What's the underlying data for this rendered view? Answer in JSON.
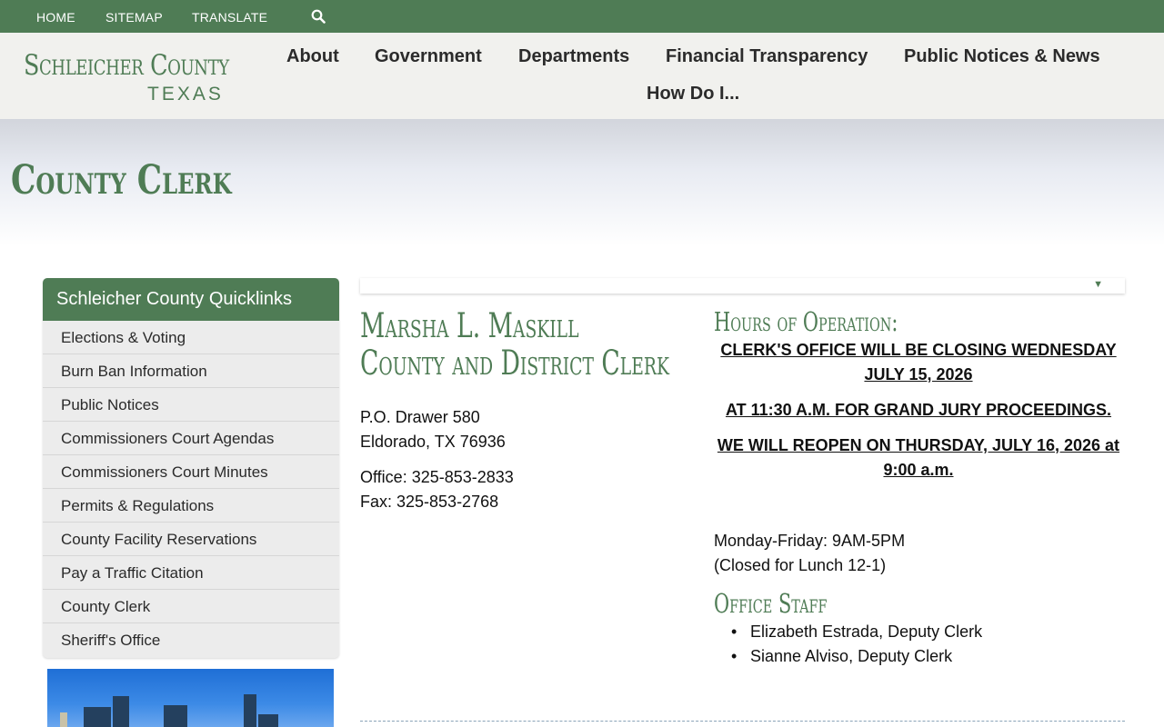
{
  "topbar": {
    "links": [
      "HOME",
      "SITEMAP",
      "TRANSLATE"
    ],
    "search_icon": "search-icon"
  },
  "header": {
    "logo_line1": "Schleicher County",
    "logo_line2": "TEXAS",
    "nav": [
      "About",
      "Government",
      "Departments",
      "Financial Transparency",
      "Public Notices & News",
      "How Do I..."
    ]
  },
  "page": {
    "title": "County Clerk"
  },
  "sidebar": {
    "heading": "Schleicher County Quicklinks",
    "items": [
      "Elections & Voting",
      "Burn Ban Information",
      "Public Notices",
      "Commissioners Court Agendas",
      "Commissioners Court Minutes",
      "Permits & Regulations",
      "County Facility Reservations",
      "Pay a Traffic Citation",
      "County Clerk",
      "Sheriff's Office"
    ]
  },
  "clerk": {
    "name": "Marsha L. Maskill",
    "role": "County and District Clerk",
    "address1": "P.O. Drawer 580",
    "address2": "Eldorado, TX 76936",
    "office": "Office: 325-853-2833",
    "fax": "Fax: 325-853-2768"
  },
  "hours": {
    "heading": "Hours of Operation:",
    "notice1": "CLERK'S OFFICE WILL BE CLOSING WEDNESDAY JULY 15, 2026",
    "notice2": "AT 11:30 A.M. FOR GRAND JURY PROCEEDINGS.",
    "notice3": "WE WILL REOPEN ON THURSDAY, JULY 16, 2026 at 9:00 a.m.",
    "weekdays": "Monday-Friday: 9AM-5PM",
    "lunch": "(Closed for Lunch 12-1)"
  },
  "staff": {
    "heading": "Office Staff",
    "members": [
      "Elizabeth Estrada, Deputy Clerk",
      "Sianne Alviso, Deputy Clerk"
    ]
  },
  "colors": {
    "brand_green": "#4f7c55",
    "header_bg": "#f1f1ee"
  }
}
